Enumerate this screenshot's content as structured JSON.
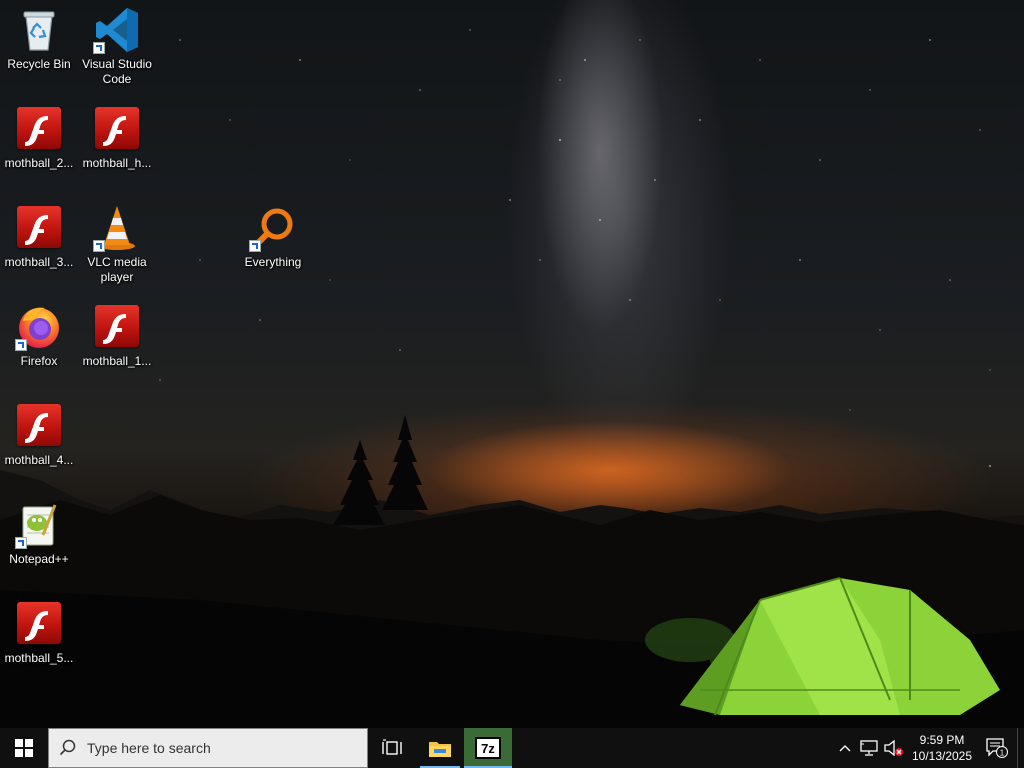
{
  "desktop": {
    "icons": [
      {
        "label": "Recycle Bin",
        "icon": "recycle-bin-icon"
      },
      {
        "label": "Visual Studio Code",
        "icon": "vscode-icon"
      },
      {
        "label": "mothball_2...",
        "icon": "flash-icon"
      },
      {
        "label": "mothball_h...",
        "icon": "flash-icon"
      },
      {
        "label": "mothball_3...",
        "icon": "flash-icon"
      },
      {
        "label": "VLC media player",
        "icon": "vlc-icon"
      },
      {
        "label": "Everything",
        "icon": "everything-search-icon"
      },
      {
        "label": "Firefox",
        "icon": "firefox-icon"
      },
      {
        "label": "mothball_1...",
        "icon": "flash-icon"
      },
      {
        "label": "mothball_4...",
        "icon": "flash-icon"
      },
      {
        "label": "Notepad++",
        "icon": "notepadpp-icon"
      },
      {
        "label": "mothball_5...",
        "icon": "flash-icon"
      }
    ]
  },
  "taskbar": {
    "search_placeholder": "Type here to search",
    "pinned": [
      {
        "name": "Task View",
        "icon": "task-view-icon"
      },
      {
        "name": "File Explorer",
        "icon": "file-explorer-icon"
      },
      {
        "name": "7-Zip",
        "icon": "7zip-icon",
        "glyph": "7z"
      }
    ],
    "tray": {
      "time": "9:59 PM",
      "date": "10/13/2025",
      "notification_count": "1"
    }
  },
  "colors": {
    "taskbar_bg": "#101010",
    "flash_red": "#d21f17",
    "tent_green": "#8cd33a",
    "accent_underline": "#76b9ed"
  }
}
